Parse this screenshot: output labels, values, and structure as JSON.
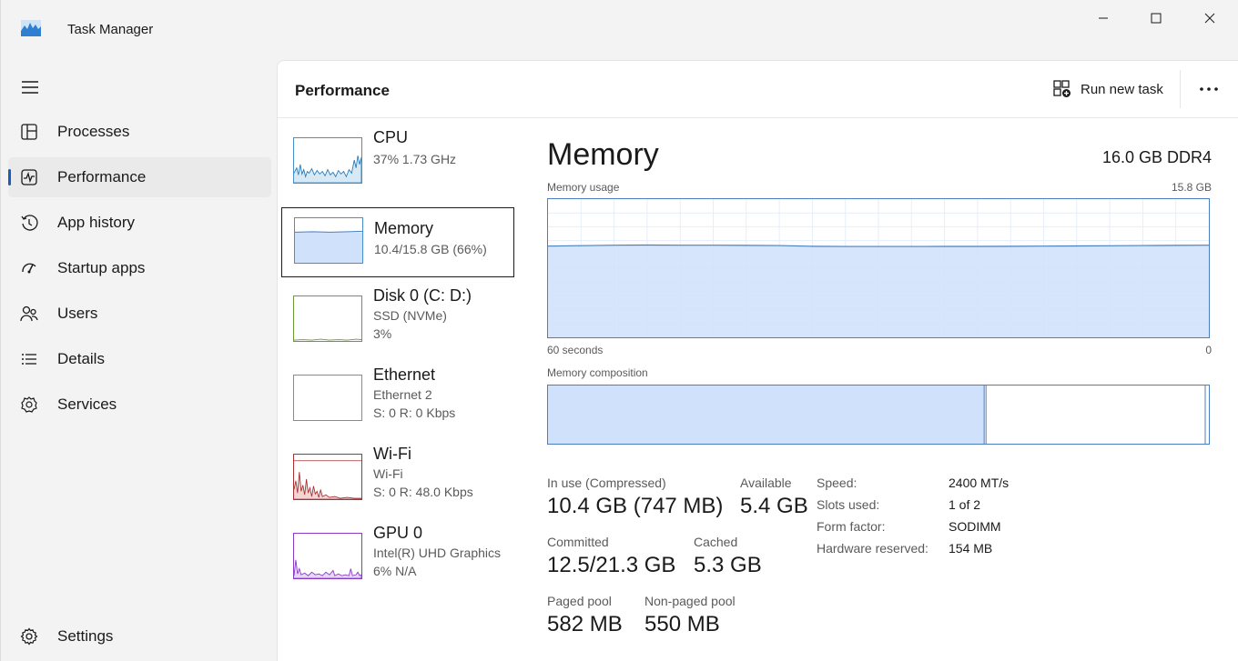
{
  "window": {
    "title": "Task Manager"
  },
  "sidebar": {
    "items": [
      {
        "label": "Processes",
        "icon": "processes-icon"
      },
      {
        "label": "Performance",
        "icon": "performance-icon",
        "active": true
      },
      {
        "label": "App history",
        "icon": "history-icon"
      },
      {
        "label": "Startup apps",
        "icon": "startup-icon"
      },
      {
        "label": "Users",
        "icon": "users-icon"
      },
      {
        "label": "Details",
        "icon": "details-icon"
      },
      {
        "label": "Services",
        "icon": "services-icon"
      }
    ],
    "settings_label": "Settings"
  },
  "header": {
    "title": "Performance",
    "run_task_label": "Run new task"
  },
  "resources": [
    {
      "name": "CPU",
      "sub1": "37%  1.73 GHz",
      "sub2": ""
    },
    {
      "name": "Memory",
      "sub1": "10.4/15.8 GB (66%)",
      "sub2": "",
      "selected": true
    },
    {
      "name": "Disk 0 (C: D:)",
      "sub1": "SSD (NVMe)",
      "sub2": "3%"
    },
    {
      "name": "Ethernet",
      "sub1": "Ethernet 2",
      "sub2": "S: 0  R: 0 Kbps"
    },
    {
      "name": "Wi-Fi",
      "sub1": "Wi-Fi",
      "sub2": "S: 0  R: 48.0 Kbps"
    },
    {
      "name": "GPU 0",
      "sub1": "Intel(R) UHD Graphics",
      "sub2": "6%  N/A"
    }
  ],
  "memory": {
    "title": "Memory",
    "spec": "16.0 GB DDR4",
    "usage_label": "Memory usage",
    "usage_max": "15.8 GB",
    "x_left": "60 seconds",
    "x_right": "0",
    "usage_fraction": 0.66,
    "composition_label": "Memory composition",
    "composition_in_use_fraction": 0.66,
    "stats": {
      "in_use_label": "In use (Compressed)",
      "in_use_value": "10.4 GB (747 MB)",
      "available_label": "Available",
      "available_value": "5.4 GB",
      "committed_label": "Committed",
      "committed_value": "12.5/21.3 GB",
      "cached_label": "Cached",
      "cached_value": "5.3 GB",
      "paged_label": "Paged pool",
      "paged_value": "582 MB",
      "nonpaged_label": "Non-paged pool",
      "nonpaged_value": "550 MB"
    },
    "props": [
      {
        "key": "Speed:",
        "value": "2400 MT/s"
      },
      {
        "key": "Slots used:",
        "value": "1 of 2"
      },
      {
        "key": "Form factor:",
        "value": "SODIMM"
      },
      {
        "key": "Hardware reserved:",
        "value": "154 MB"
      }
    ]
  },
  "colors": {
    "accent": "#1a5fb4",
    "memory_fill": "#cfe1fb",
    "memory_line": "#4a7fbf",
    "cpu_line": "#2a7ab8",
    "wifi_line": "#a83232",
    "gpu_line": "#8a3ac4"
  }
}
